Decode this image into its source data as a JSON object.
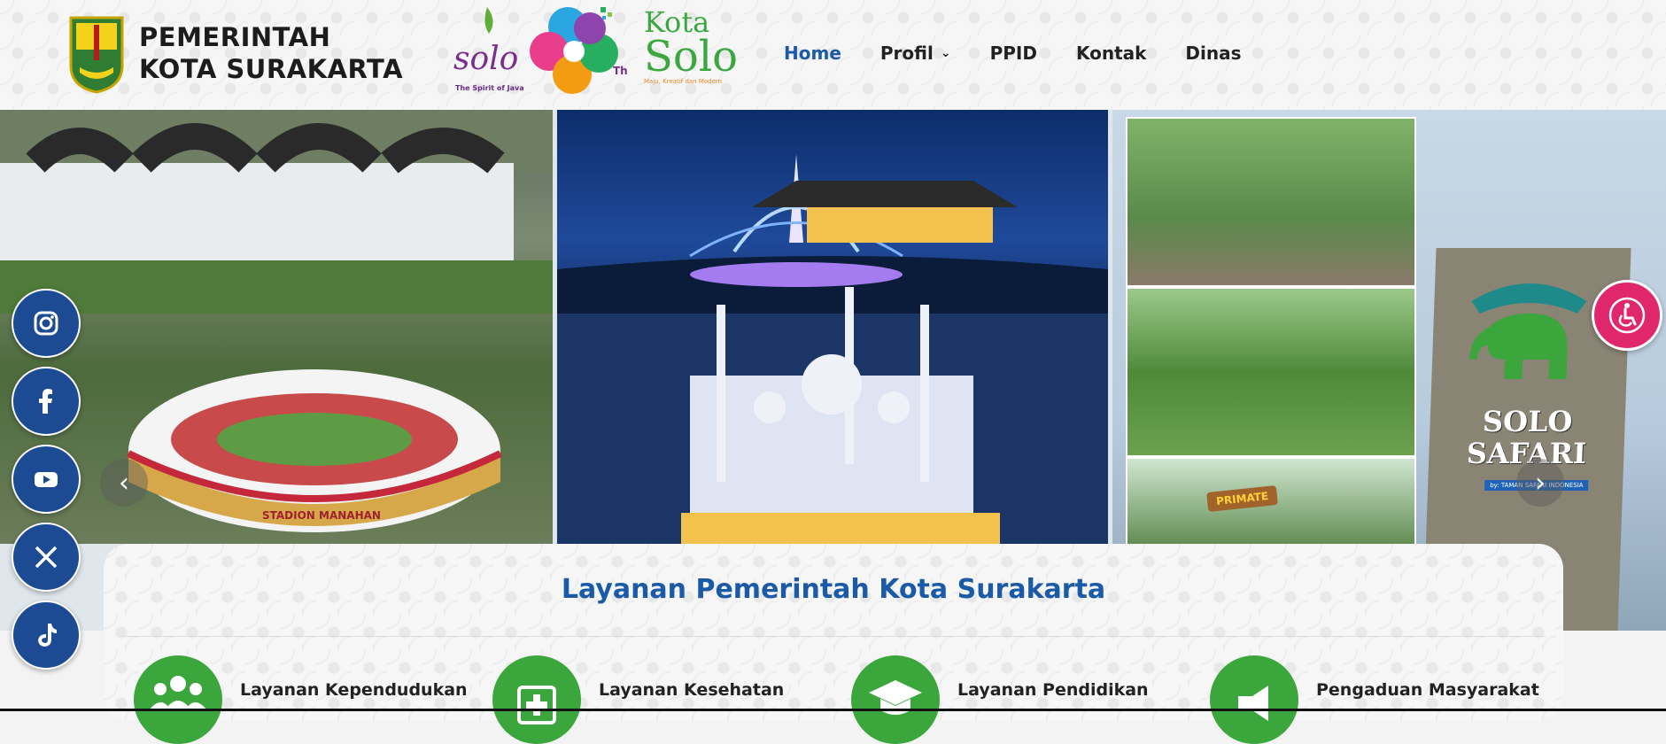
{
  "header": {
    "brand_line1": "PEMERINTAH",
    "brand_line2": "KOTA SURAKARTA",
    "solo_tagline": "The Spirit of Java",
    "anniversary_suffix": "Th",
    "kota_line1": "Kota",
    "kota_line2": "Solo",
    "kota_slogan": "Maju, Kreatif dan Modern"
  },
  "nav": {
    "items": [
      {
        "label": "Home",
        "active": true
      },
      {
        "label": "Profil",
        "has_dropdown": true
      },
      {
        "label": "PPID"
      },
      {
        "label": "Kontak"
      },
      {
        "label": "Dinas"
      }
    ]
  },
  "hero": {
    "stadium_sign": "STADION MANAHAN",
    "safari_sign_line1": "SOLO",
    "safari_sign_line2": "SAFARI",
    "safari_badge": "by: TAMAN SAFARI INDONESIA",
    "primate_sign": "PRIMATE",
    "prev_icon": "chevron-left-icon",
    "next_icon": "chevron-right-icon"
  },
  "socials": [
    "instagram-icon",
    "facebook-icon",
    "youtube-icon",
    "x-icon",
    "tiktok-icon"
  ],
  "services": {
    "title": "Layanan Pemerintah Kota Surakarta",
    "items": [
      {
        "label": "Layanan Kependudukan",
        "icon": "people-icon"
      },
      {
        "label": "Layanan Kesehatan",
        "icon": "medical-kit-icon"
      },
      {
        "label": "Layanan Pendidikan",
        "icon": "graduation-cap-icon"
      },
      {
        "label": "Pengaduan Masyarakat",
        "icon": "megaphone-icon"
      }
    ]
  },
  "colors": {
    "brand_blue": "#1b5aa6",
    "social_blue": "#1c4b94",
    "service_green": "#3aa63c",
    "accessibility_pink": "#e0266d"
  }
}
